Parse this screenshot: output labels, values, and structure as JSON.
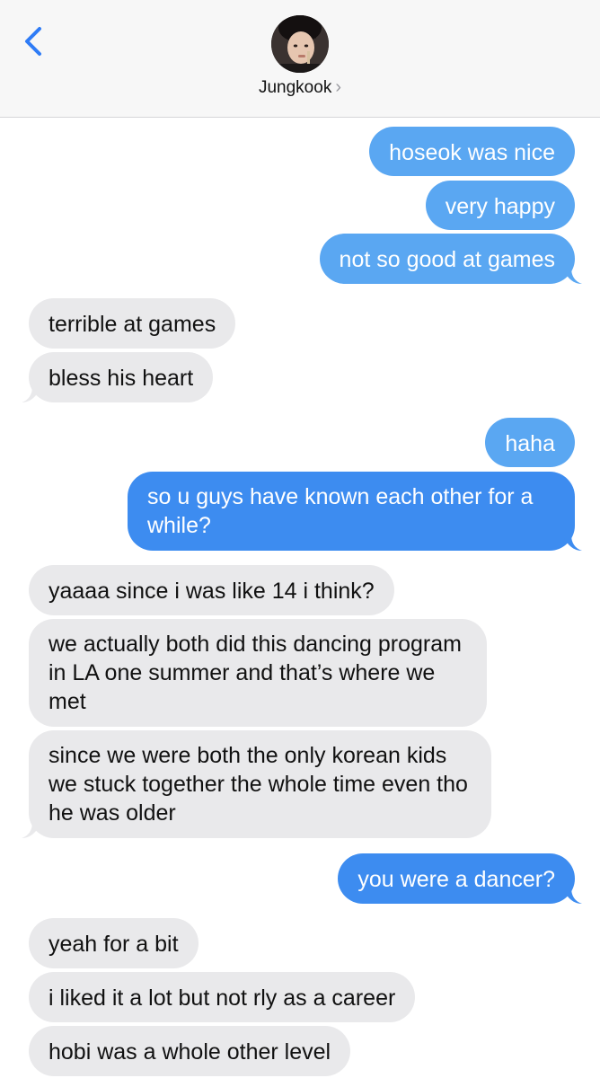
{
  "header": {
    "contact_name": "Jungkook",
    "chevron": "›",
    "back_icon": "chevron-left-icon",
    "accent_color": "#2f7cf6"
  },
  "colors": {
    "sent_bubble": "#5aa7f2",
    "sent_bubble_latest": "#3d8cf0",
    "received_bubble": "#e9e9eb"
  },
  "messages": [
    {
      "from": "me",
      "text": "hoseok was nice"
    },
    {
      "from": "me",
      "text": "very happy"
    },
    {
      "from": "me",
      "text": "not so good at games"
    },
    {
      "from": "them",
      "text": "terrible at games"
    },
    {
      "from": "them",
      "text": "bless his heart"
    },
    {
      "from": "me",
      "text": "haha"
    },
    {
      "from": "me",
      "text": "so u guys have known each other for a while?"
    },
    {
      "from": "them",
      "text": "yaaaa since i was like 14 i think?"
    },
    {
      "from": "them",
      "text": "we actually both did this dancing program in LA one summer and that’s where we met"
    },
    {
      "from": "them",
      "text": "since we were both the only korean kids we stuck together the whole time even tho he was older"
    },
    {
      "from": "me",
      "text": "you were a dancer?"
    },
    {
      "from": "them",
      "text": "yeah for a bit"
    },
    {
      "from": "them",
      "text": "i liked it a lot but not rly as a career"
    },
    {
      "from": "them",
      "text": "hobi was a whole other level"
    }
  ]
}
